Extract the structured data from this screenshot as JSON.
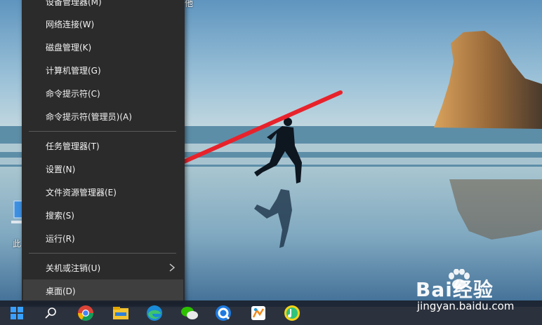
{
  "menu": {
    "items": [
      {
        "label": "设备管理器(M)"
      },
      {
        "label": "网络连接(W)"
      },
      {
        "label": "磁盘管理(K)"
      },
      {
        "label": "计算机管理(G)"
      },
      {
        "label": "命令提示符(C)"
      },
      {
        "label": "命令提示符(管理员)(A)"
      },
      {
        "label": "任务管理器(T)"
      },
      {
        "label": "设置(N)"
      },
      {
        "label": "文件资源管理器(E)"
      },
      {
        "label": "搜索(S)"
      },
      {
        "label": "运行(R)"
      },
      {
        "label": "关机或注销(U)"
      },
      {
        "label": "桌面(D)"
      }
    ]
  },
  "desktop": {
    "partial_label_left": "此",
    "partial_label_top": "他"
  },
  "watermark": {
    "brand": "Bai经验",
    "url": "jingyan.baidu.com"
  },
  "colors": {
    "menu_bg": "#2b2b2b",
    "menu_selected": "#3f3f3f",
    "arrow": "#e8222b",
    "taskbar": "#1a212c"
  },
  "icons": {
    "taskbar": [
      "windows-start-icon",
      "search-icon",
      "chrome-icon",
      "file-explorer-icon",
      "edge-icon",
      "wechat-icon",
      "qq-browser-icon",
      "painting-app-icon",
      "qq-music-icon"
    ]
  }
}
